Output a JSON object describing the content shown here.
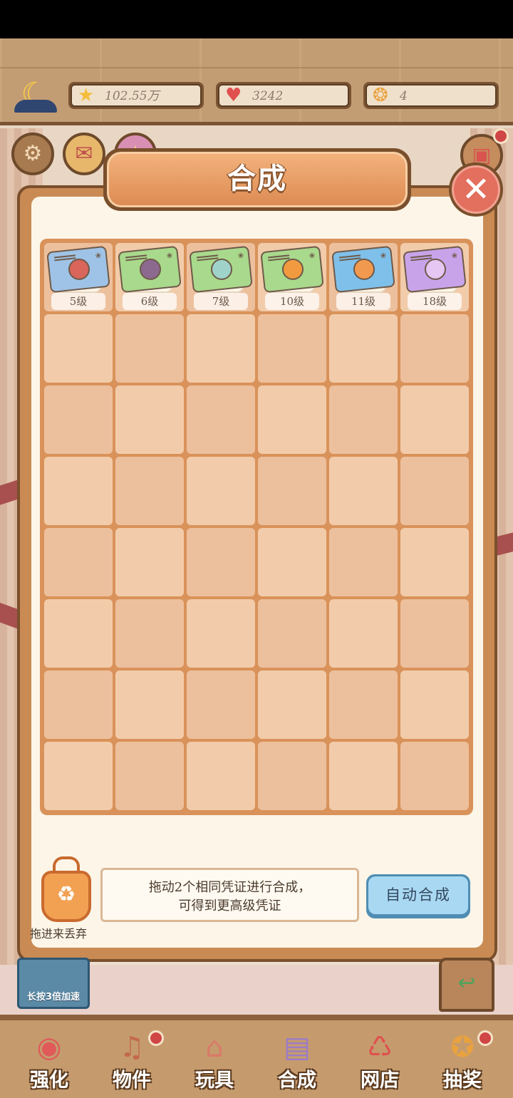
{
  "currencies": [
    {
      "icon": "star-icon",
      "glyph": "★",
      "value": "102.55万",
      "color": "#f3bd3a"
    },
    {
      "icon": "heart-icon",
      "glyph": "♥",
      "value": "3242",
      "color": "#e0504e"
    },
    {
      "icon": "paw-coin-icon",
      "glyph": "❂",
      "value": "4",
      "color": "#e9a23e"
    }
  ],
  "modal": {
    "title": "合成",
    "close_glyph": "✕",
    "levels": [
      "5级",
      "6级",
      "7级",
      "10级",
      "11级",
      "18级"
    ],
    "card_colors": [
      "#9fc3e6",
      "#a9d98c",
      "#a9d98c",
      "#a9d98c",
      "#7fc0ea",
      "#c9a3ea"
    ],
    "pic_colors": [
      "#d9655b",
      "#8c6a8f",
      "#9fd3c9",
      "#f19a3f",
      "#f19a4f",
      "#e6c6f3"
    ],
    "trash_label": "拖进来丢弃",
    "hint_line1": "拖动2个相同凭证进行合成，",
    "hint_line2": "可得到更高级凭证",
    "auto_button": "自动合成"
  },
  "speed_button": "长按3倍加速",
  "nav": [
    {
      "label": "强化",
      "icon": "lollipop-icon",
      "glyph": "◉"
    },
    {
      "label": "物件",
      "icon": "piano-icon",
      "glyph": "♫"
    },
    {
      "label": "玩具",
      "icon": "toy-house-icon",
      "glyph": "⌂"
    },
    {
      "label": "合成",
      "icon": "cards-icon",
      "glyph": "▤"
    },
    {
      "label": "网店",
      "icon": "shop-basket-icon",
      "glyph": "♺"
    },
    {
      "label": "抽奖",
      "icon": "wheel-icon",
      "glyph": "✪"
    }
  ]
}
